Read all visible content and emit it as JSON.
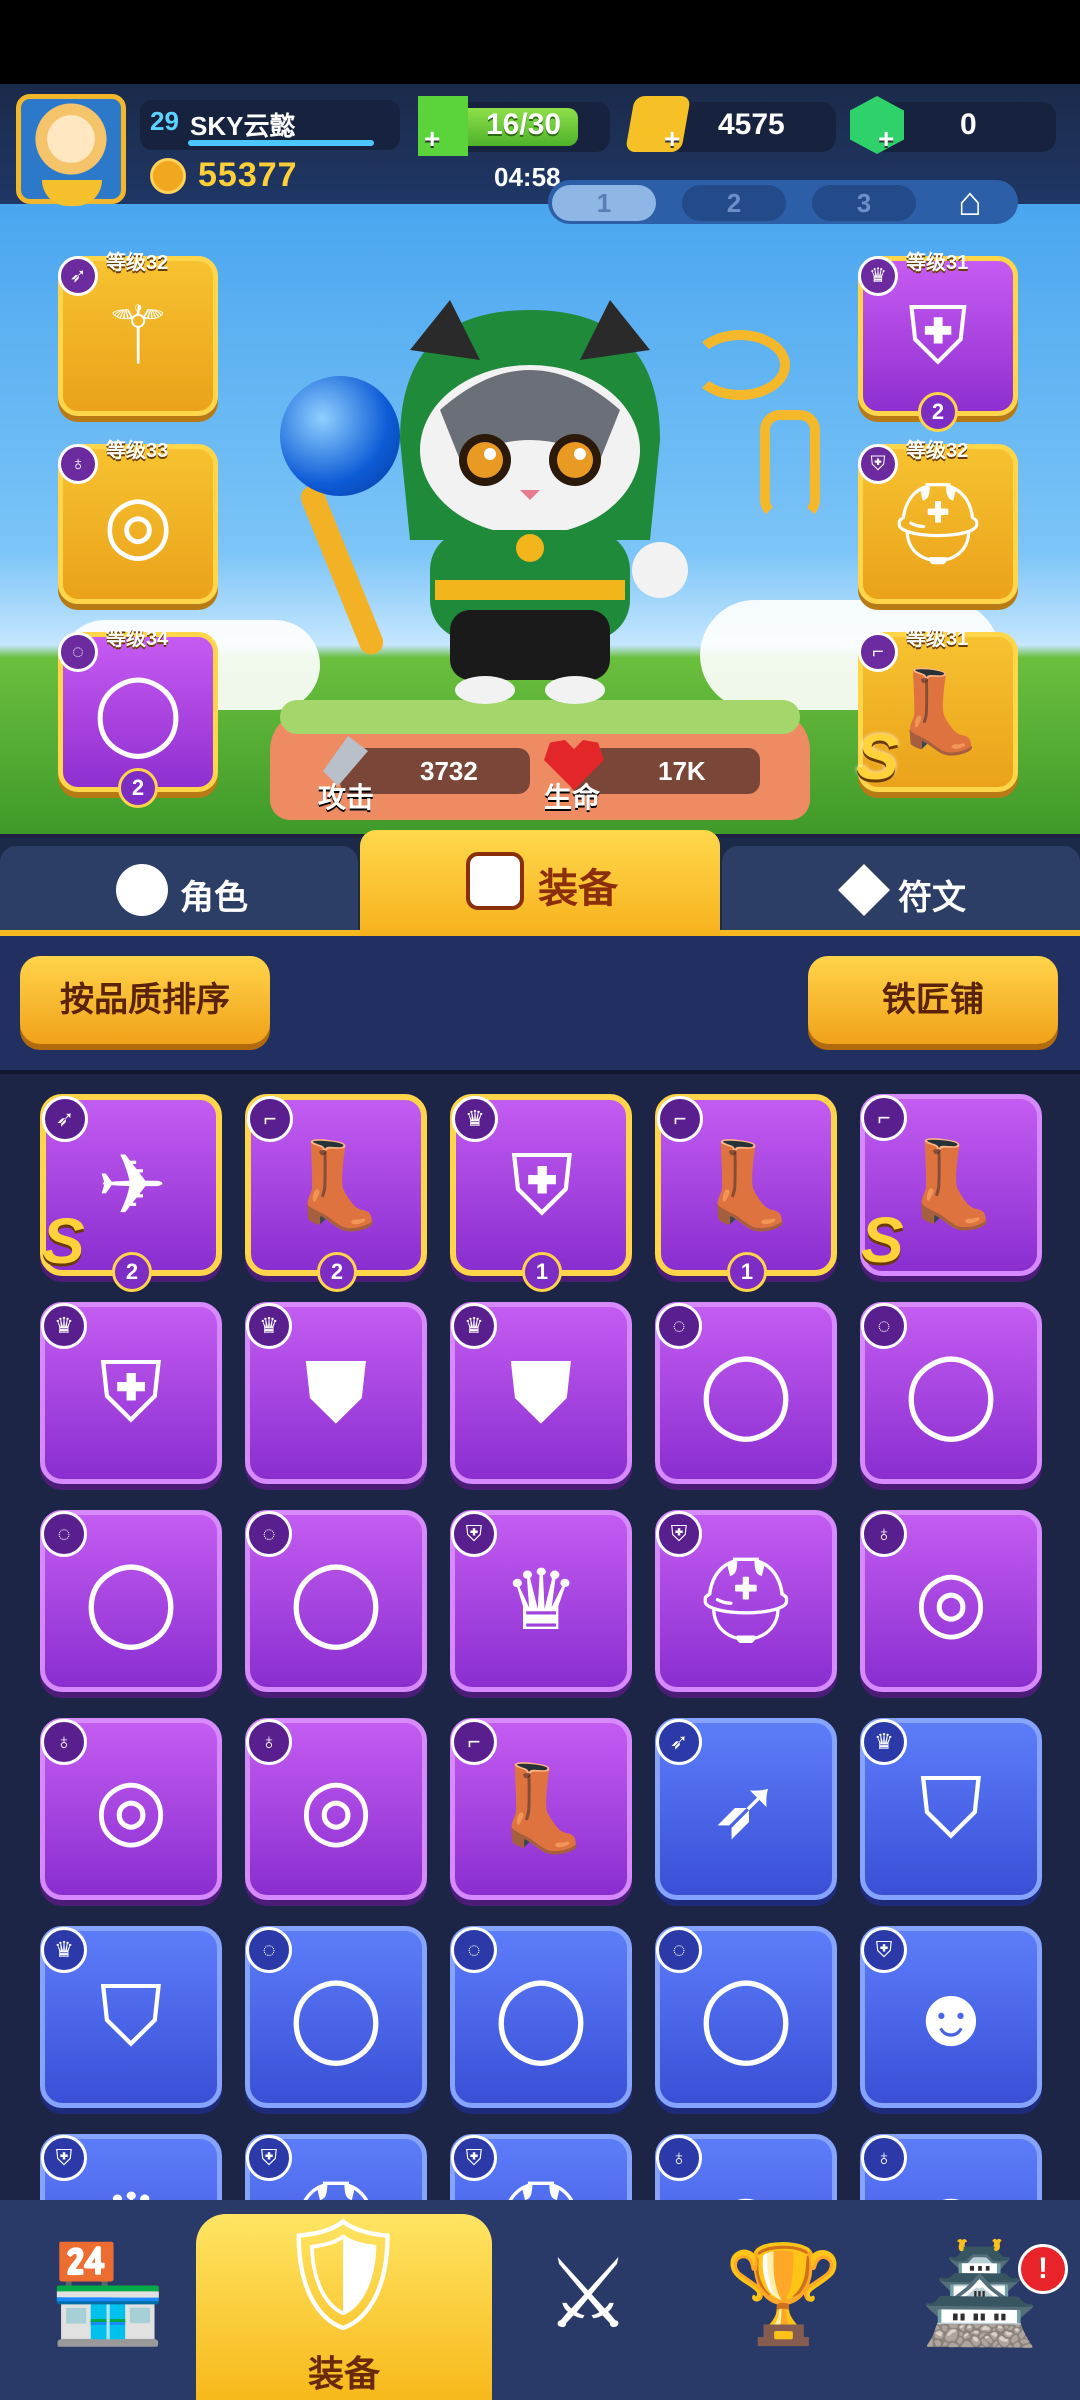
{
  "player": {
    "level": "29",
    "name": "SKY云懿",
    "power": "55377",
    "xp_fraction": 1.0
  },
  "resources": {
    "energy": "16/30",
    "energy_fraction": 0.53,
    "timer": "04:58",
    "gold": "4575",
    "gems": "0"
  },
  "loadout_tabs": [
    "1",
    "2",
    "3"
  ],
  "equipped": {
    "left": [
      {
        "level_label": "等级32",
        "type_icon": "bow-icon",
        "item_icon": "staff-icon",
        "style": "gold"
      },
      {
        "level_label": "等级33",
        "type_icon": "necklace-icon",
        "item_icon": "necklace-icon",
        "style": "gold"
      },
      {
        "level_label": "等级34",
        "type_icon": "ring-icon",
        "item_icon": "ring-icon",
        "style": "purple",
        "badge": "2"
      }
    ],
    "right": [
      {
        "level_label": "等级31",
        "type_icon": "armor-icon",
        "item_icon": "armor-icon",
        "style": "purple",
        "badge": "2"
      },
      {
        "level_label": "等级32",
        "type_icon": "helmet-icon",
        "item_icon": "helmet-icon",
        "style": "gold"
      },
      {
        "level_label": "等级31",
        "type_icon": "boots-icon",
        "item_icon": "boots-icon",
        "style": "gold",
        "tier": "S"
      }
    ]
  },
  "stats": {
    "attack_label": "攻击",
    "attack_value": "3732",
    "hp_label": "生命",
    "hp_value": "17K"
  },
  "tabs": {
    "role": "角色",
    "equipment": "装备",
    "rune": "符文"
  },
  "buttons": {
    "sort": "按品质排序",
    "blacksmith": "铁匠铺"
  },
  "inventory": [
    {
      "type": "bow-icon",
      "item": "crossbow-icon",
      "rarity": "purple",
      "gold_border": true,
      "tier": "S",
      "stack": "2"
    },
    {
      "type": "boots-icon",
      "item": "boots-icon",
      "rarity": "purple",
      "gold_border": true,
      "stack": "2"
    },
    {
      "type": "armor-icon",
      "item": "armor-icon",
      "rarity": "purple",
      "gold_border": true,
      "stack": "1"
    },
    {
      "type": "boots-icon",
      "item": "boots-icon",
      "rarity": "purple",
      "gold_border": true,
      "stack": "1"
    },
    {
      "type": "boots-icon",
      "item": "winged-boots-icon",
      "rarity": "purple",
      "tier": "S"
    },
    {
      "type": "armor-icon",
      "item": "armor-icon",
      "rarity": "purple"
    },
    {
      "type": "armor-icon",
      "item": "chestplate-icon",
      "rarity": "purple"
    },
    {
      "type": "armor-icon",
      "item": "chestplate-icon",
      "rarity": "purple"
    },
    {
      "type": "ring-icon",
      "item": "ring-icon",
      "rarity": "purple"
    },
    {
      "type": "ring-icon",
      "item": "ring-icon",
      "rarity": "purple"
    },
    {
      "type": "ring-icon",
      "item": "ring-icon",
      "rarity": "purple"
    },
    {
      "type": "ring-icon",
      "item": "ring-icon",
      "rarity": "purple"
    },
    {
      "type": "helmet-icon",
      "item": "crown-icon",
      "rarity": "purple"
    },
    {
      "type": "helmet-icon",
      "item": "helmet-icon",
      "rarity": "purple"
    },
    {
      "type": "necklace-icon",
      "item": "necklace-icon",
      "rarity": "purple"
    },
    {
      "type": "necklace-icon",
      "item": "necklace-icon",
      "rarity": "purple"
    },
    {
      "type": "necklace-icon",
      "item": "necklace-icon",
      "rarity": "purple"
    },
    {
      "type": "boots-icon",
      "item": "boots-icon",
      "rarity": "purple"
    },
    {
      "type": "bow-icon",
      "item": "bow-icon",
      "rarity": "blue"
    },
    {
      "type": "armor-icon",
      "item": "cloak-icon",
      "rarity": "blue"
    },
    {
      "type": "armor-icon",
      "item": "cloak-icon",
      "rarity": "blue"
    },
    {
      "type": "ring-icon",
      "item": "ring-icon",
      "rarity": "blue"
    },
    {
      "type": "ring-icon",
      "item": "ring-icon",
      "rarity": "blue"
    },
    {
      "type": "ring-icon",
      "item": "ring-icon",
      "rarity": "blue"
    },
    {
      "type": "helmet-icon",
      "item": "mask-icon",
      "rarity": "blue"
    },
    {
      "type": "helmet-icon",
      "item": "crown-icon",
      "rarity": "blue"
    },
    {
      "type": "helmet-icon",
      "item": "helmet-icon",
      "rarity": "blue"
    },
    {
      "type": "helmet-icon",
      "item": "helmet-icon",
      "rarity": "blue"
    },
    {
      "type": "necklace-icon",
      "item": "necklace-icon",
      "rarity": "blue"
    },
    {
      "type": "necklace-icon",
      "item": "necklace-icon",
      "rarity": "blue"
    }
  ],
  "nav": [
    {
      "icon": "shop-icon"
    },
    {
      "icon": "equipment-icon",
      "label": "装备",
      "active": true
    },
    {
      "icon": "battle-shield-icon"
    },
    {
      "icon": "trophy-icon"
    },
    {
      "icon": "guild-icon",
      "alert": "!"
    }
  ],
  "colors": {
    "accent_gold": "#f7b21d",
    "rarity_purple": "#a844e0",
    "rarity_blue": "#4a64e8",
    "alert_red": "#e8232a"
  }
}
